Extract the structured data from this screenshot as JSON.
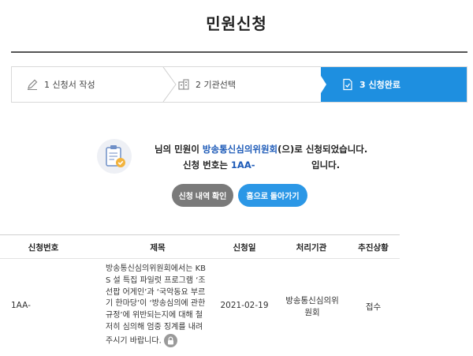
{
  "page": {
    "title": "민원신청"
  },
  "steps": [
    {
      "label": "1 신청서 작성",
      "icon": "pencil-icon"
    },
    {
      "label": "2 기관선택",
      "icon": "building-icon"
    },
    {
      "label": "3 신청완료",
      "icon": "document-check-icon"
    }
  ],
  "notice": {
    "line1_prefix": "님의 민원이 ",
    "org": "방송통신심의위원회",
    "line1_suffix": "(으)로 신청되었습니다.",
    "line2_prefix": "신청 번호는 ",
    "number": "1AA-",
    "line2_suffix": "입니다."
  },
  "buttons": {
    "history": "신청 내역 확인",
    "home": "홈으로 돌아가기"
  },
  "table": {
    "headers": [
      "신청번호",
      "제목",
      "신청일",
      "처리기관",
      "추진상황"
    ],
    "rows": [
      {
        "number": "1AA-",
        "subject": "방송통신심의위원회에서는 KBS 설 특집 파일럿 프로그램 ‘조선팝 어게인’과 ‘국악동요 부르기 한마당’이 ‘방송심의에 관한 규정’에 위반되는지에 대해 철저히 심의해 엄중 징계를 내려 주시기 바랍니다.",
        "date": "2021-02-19",
        "agency": "방송통신심의위원회",
        "status": "접수"
      }
    ]
  },
  "colors": {
    "accent": "#1e8fe0",
    "org_text": "#1e5bb8",
    "gray_button": "#7a7a7a",
    "blue_button": "#2b97e6"
  }
}
